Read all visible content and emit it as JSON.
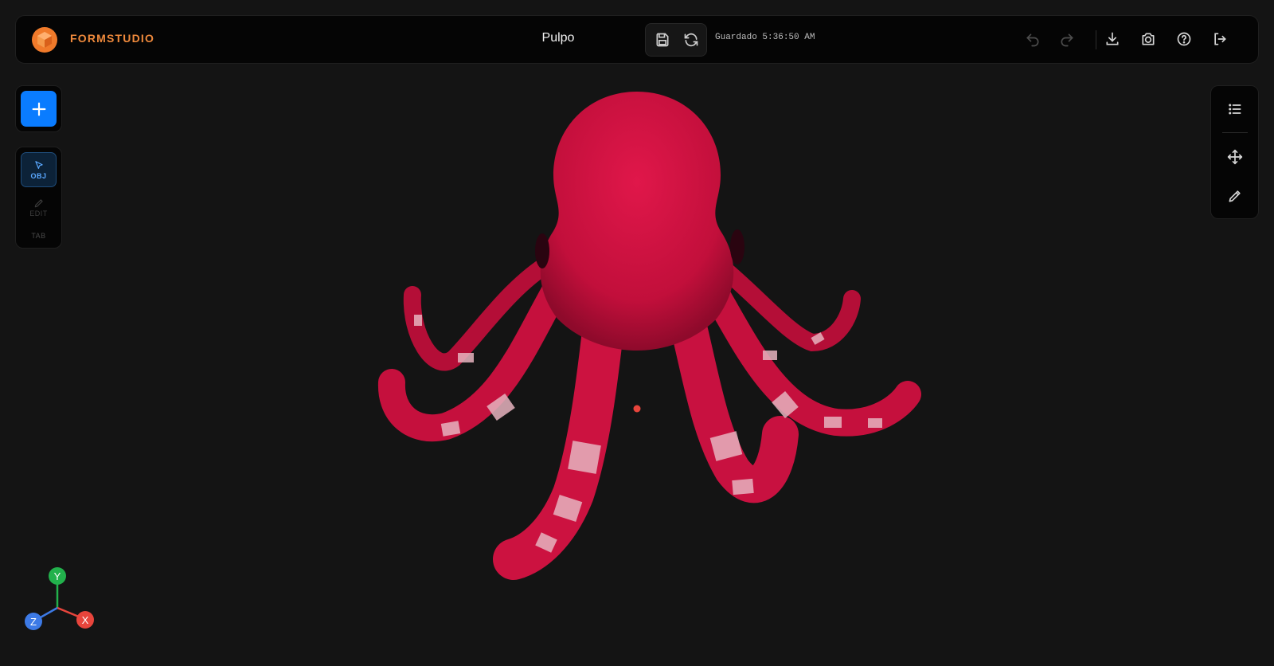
{
  "app": {
    "brand": "FORMSTUDIO",
    "document_title": "Pulpo"
  },
  "toolbar": {
    "save_status": "Guardado 5:36:50 AM",
    "icons": [
      "save-icon",
      "sync-icon",
      "undo-icon",
      "redo-icon",
      "download-icon",
      "camera-icon",
      "help-icon",
      "logout-icon"
    ]
  },
  "left_tools": {
    "modes": [
      {
        "label": "OBJ",
        "active": true
      },
      {
        "label": "EDIT",
        "active": false
      }
    ],
    "hint": "TAB"
  },
  "right_tools": {
    "icons": [
      "list-icon",
      "move-icon",
      "pencil-icon"
    ]
  },
  "viewport": {
    "object": "octopus",
    "object_color": "#c8103c",
    "stripe_color": "#e7b3bf",
    "background": "#141414"
  },
  "axis_gizmo": {
    "x_label": "X",
    "y_label": "Y",
    "z_label": "Z",
    "x_color": "#e8453c",
    "y_color": "#22b14c",
    "z_color": "#3d7ae6"
  },
  "colors": {
    "accent": "#0a7cff",
    "brand": "#f08a3c"
  }
}
